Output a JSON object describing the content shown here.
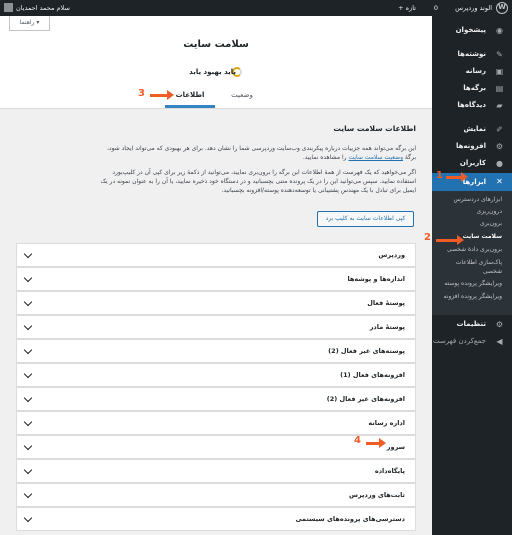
{
  "adminbar": {
    "site_name": "الوند وردپرس",
    "new_label": "+ تازه",
    "comments_count": "0",
    "user_greeting": "سلام محمد احمدیان"
  },
  "sidebar": {
    "items": [
      {
        "label": "پیشخوان",
        "icon": "dashboard-icon"
      },
      {
        "label": "نوشته‌ها",
        "icon": "pin-icon"
      },
      {
        "label": "رسانه",
        "icon": "media-icon"
      },
      {
        "label": "برگه‌ها",
        "icon": "page-icon"
      },
      {
        "label": "دیدگاه‌ها",
        "icon": "comment-icon"
      },
      {
        "label": "نمایش",
        "icon": "brush-icon"
      },
      {
        "label": "افزونه‌ها",
        "icon": "plugin-icon"
      },
      {
        "label": "کاربران",
        "icon": "user-icon"
      },
      {
        "label": "ابزارها",
        "icon": "wrench-icon"
      },
      {
        "label": "تنظیمات",
        "icon": "settings-icon"
      },
      {
        "label": "جمع‌کردن فهرست",
        "icon": "collapse-icon"
      }
    ],
    "submenu": [
      {
        "label": "ابزارهای دردسترس"
      },
      {
        "label": "درون‌ریزی"
      },
      {
        "label": "برون‌بری"
      },
      {
        "label": "سلامت سایت"
      },
      {
        "label": "برون‌بری دادهٔ شخصی"
      },
      {
        "label": "پاک‌سازی اطلاعات شخصی"
      },
      {
        "label": "ویرایشگر پرونده پوسته"
      },
      {
        "label": "ویرایشگر پرونده افزونه"
      }
    ]
  },
  "help_label": "راهنما ▾",
  "header": {
    "title": "سلامت سایت",
    "status": "باید بهبود یابد",
    "tab_info": "اطلاعات",
    "tab_status": "وضعیت"
  },
  "main": {
    "section_title": "اطلاعات سلامت سایت",
    "para1_a": "این برگه می‌تواند همه جزییات درباره پیکربندی وب‌سایت وردپرسی شما را نشان دهد. برای هر بهبودی که می‌تواند ایجاد شود، برگهٔ ",
    "para1_link": "وضعیت سلامت سایت",
    "para1_b": " را مشاهده نمایید.",
    "para2": "اگر می‌خواهید که یک فهرست از همهٔ اطلاعات این برگه را برون‌بری نمایید، می‌توانید از دکمهٔ زیر برای کپی آن در کلیپ‌بورد استفاده نمایید. سپس می‌توانید این را در یک پرونده متنی بچسبانید و در دستگاه خود ذخیره نمایید، یا آن را به عنوان نمونه در یک ایمیل برای تبادل با یک مهندس پشتیبانی یا توسعه‌دهنده پوسته/افزونه بچسبانید.",
    "copy_button": "کپی اطلاعات سایت به کلیپ برد"
  },
  "sections": [
    "وردپرس",
    "اندازه‌ها و پوشه‌ها",
    "پوستهٔ فعال",
    "پوستهٔ مادر",
    "پوسته‌های غیر فعال (2)",
    "افزونه‌های فعال (1)",
    "افزونه‌های غیر فعال (2)",
    "اداره رسانه",
    "سرور",
    "پایگاه‌داده",
    "ثابت‌های وردپرس",
    "دسترسی‌های پرونده‌های سیستمی"
  ],
  "annotations": [
    "1",
    "2",
    "3",
    "4"
  ],
  "colors": {
    "accent": "#2271b1",
    "annotation": "#ef5c26",
    "sidebar_bg": "#1d2327",
    "warning": "#dba617"
  }
}
